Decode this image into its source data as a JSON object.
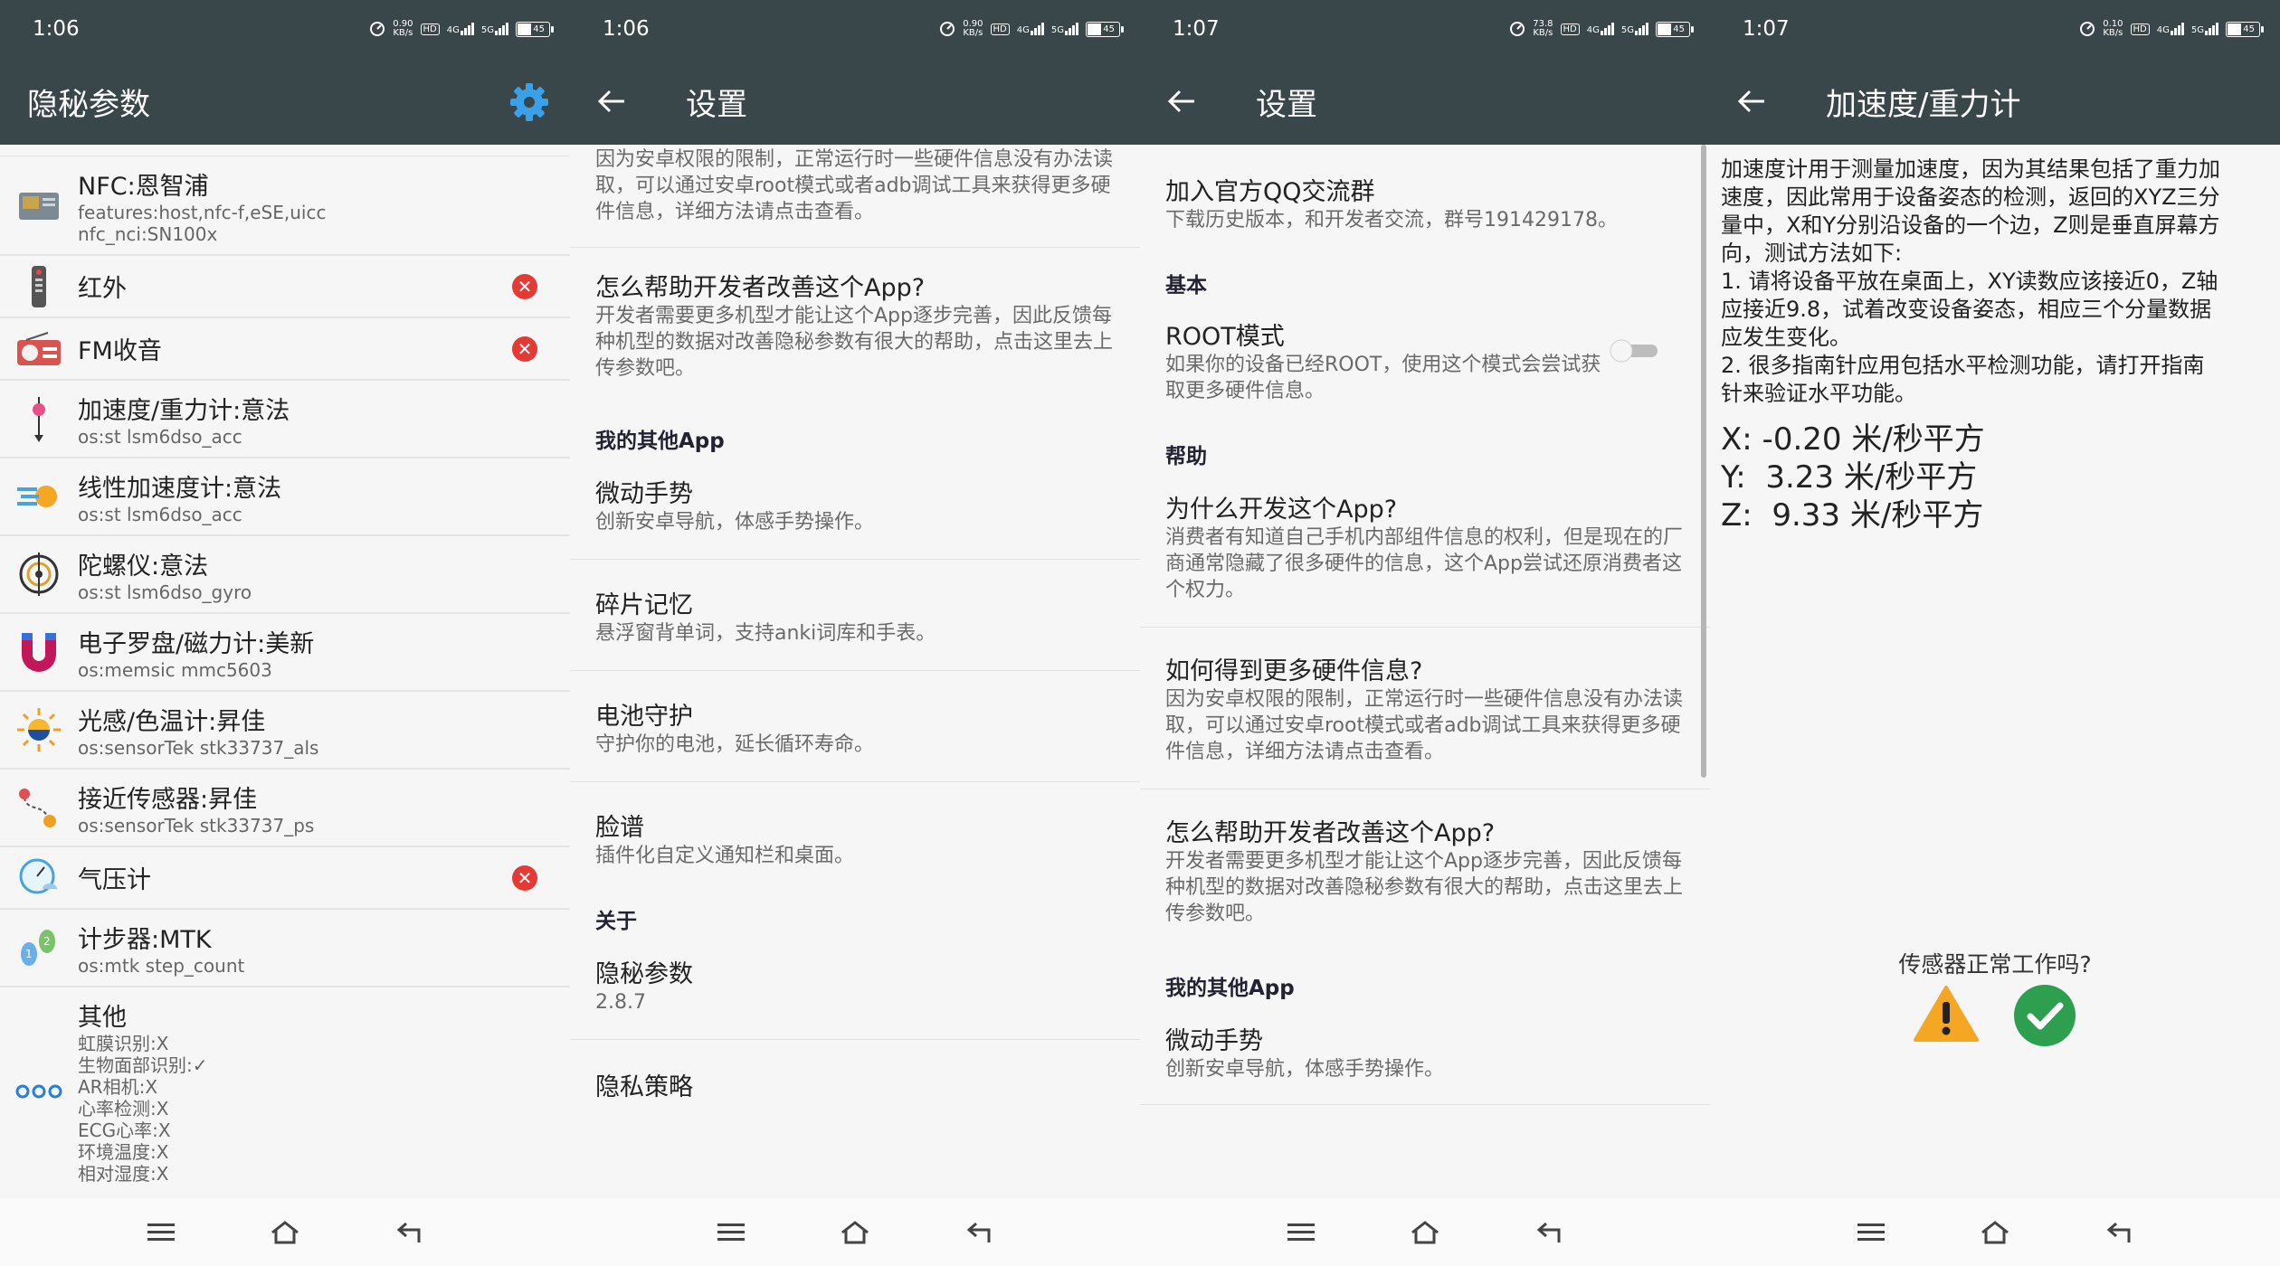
{
  "status": [
    {
      "time": "1:06",
      "speed_top": "0.90",
      "speed_unit": "KB/s",
      "hd": "HD",
      "net1": "4G",
      "net2": "5G",
      "battery": "45"
    },
    {
      "time": "1:06",
      "speed_top": "0.90",
      "speed_unit": "KB/s",
      "hd": "HD",
      "net1": "4G",
      "net2": "5G",
      "battery": "45"
    },
    {
      "time": "1:07",
      "speed_top": "73.8",
      "speed_unit": "KB/s",
      "hd": "HD",
      "net1": "4G",
      "net2": "5G",
      "battery": "45"
    },
    {
      "time": "1:07",
      "speed_top": "0.10",
      "speed_unit": "KB/s",
      "hd": "HD",
      "net1": "4G",
      "net2": "5G",
      "battery": "45"
    }
  ],
  "screen1": {
    "title": "隐秘参数",
    "sensors": [
      {
        "name": "NFC:恩智浦",
        "sub": [
          "features:host,nfc-f,eSE,uicc",
          "nfc_nci:SN100x"
        ],
        "icon": "nfc-chip-icon",
        "error": false
      },
      {
        "name": "红外",
        "sub": [],
        "icon": "remote-control-icon",
        "error": true
      },
      {
        "name": "FM收音",
        "sub": [],
        "icon": "radio-icon",
        "error": true
      },
      {
        "name": "加速度/重力计:意法",
        "sub": [
          "os:st lsm6dso_acc"
        ],
        "icon": "gravity-pendulum-icon",
        "error": false
      },
      {
        "name": "线性加速度计:意法",
        "sub": [
          "os:st lsm6dso_acc"
        ],
        "icon": "speed-lines-icon",
        "error": false
      },
      {
        "name": "陀螺仪:意法",
        "sub": [
          "os:st lsm6dso_gyro"
        ],
        "icon": "gyroscope-icon",
        "error": false
      },
      {
        "name": "电子罗盘/磁力计:美新",
        "sub": [
          "os:memsic mmc5603"
        ],
        "icon": "magnet-icon",
        "error": false
      },
      {
        "name": "光感/色温计:昇佳",
        "sub": [
          "os:sensorTek stk33737_als"
        ],
        "icon": "sun-icon",
        "error": false
      },
      {
        "name": "接近传感器:昇佳",
        "sub": [
          "os:sensorTek stk33737_ps"
        ],
        "icon": "location-route-icon",
        "error": false
      },
      {
        "name": "气压计",
        "sub": [],
        "icon": "weather-gauge-icon",
        "error": true
      },
      {
        "name": "计步器:MTK",
        "sub": [
          "os:mtk step_count"
        ],
        "icon": "footsteps-icon",
        "error": false
      },
      {
        "name": "其他",
        "sub": [
          "虹膜识别:X",
          "生物面部识别:✓",
          "AR相机:X",
          "心率检测:X",
          "ECG心率:X",
          "环境温度:X",
          "相对湿度:X"
        ],
        "icon": "more-dots-icon",
        "error": false
      }
    ]
  },
  "screen2": {
    "title": "设置",
    "top_desc": "因为安卓权限的限制，正常运行时一些硬件信息没有办法读取，可以通过安卓root模式或者adb调试工具来获得更多硬件信息，详细方法请点击查看。",
    "items_a": [
      {
        "title": "怎么帮助开发者改善这个App?",
        "desc": "开发者需要更多机型才能让这个App逐步完善，因此反馈每种机型的数据对改善隐秘参数有很大的帮助，点击这里去上传参数吧。"
      }
    ],
    "cat_other": "我的其他App",
    "items_b": [
      {
        "title": "微动手势",
        "desc": "创新安卓导航，体感手势操作。"
      },
      {
        "title": "碎片记忆",
        "desc": "悬浮窗背单词，支持anki词库和手表。"
      },
      {
        "title": "电池守护",
        "desc": "守护你的电池，延长循环寿命。"
      },
      {
        "title": "脸谱",
        "desc": "插件化自定义通知栏和桌面。"
      }
    ],
    "cat_about": "关于",
    "items_c": [
      {
        "title": "隐秘参数",
        "desc": "2.8.7"
      },
      {
        "title": "隐私策略",
        "desc": ""
      }
    ]
  },
  "screen3": {
    "title": "设置",
    "qq": {
      "title": "加入官方QQ交流群",
      "desc": "下载历史版本，和开发者交流，群号191429178。"
    },
    "cat_basic": "基本",
    "root": {
      "title": "ROOT模式",
      "desc": "如果你的设备已经ROOT，使用这个模式会尝试获取更多硬件信息。",
      "enabled": false
    },
    "cat_help": "帮助",
    "help_items": [
      {
        "title": "为什么开发这个App?",
        "desc": "消费者有知道自己手机内部组件信息的权利，但是现在的厂商通常隐藏了很多硬件的信息，这个App尝试还原消费者这个权力。"
      },
      {
        "title": "如何得到更多硬件信息?",
        "desc": "因为安卓权限的限制，正常运行时一些硬件信息没有办法读取，可以通过安卓root模式或者adb调试工具来获得更多硬件信息，详细方法请点击查看。"
      },
      {
        "title": "怎么帮助开发者改善这个App?",
        "desc": "开发者需要更多机型才能让这个App逐步完善，因此反馈每种机型的数据对改善隐秘参数有很大的帮助，点击这里去上传参数吧。"
      }
    ],
    "cat_other": "我的其他App",
    "other_items": [
      {
        "title": "微动手势",
        "desc": "创新安卓导航，体感手势操作。"
      }
    ]
  },
  "screen4": {
    "title": "加速度/重力计",
    "desc_lines": [
      "加速度计用于测量加速度，因为其结果包括了重力加",
      "速度，因此常用于设备姿态的检测，返回的XYZ三分",
      "量中，X和Y分别沿设备的一个边，Z则是垂直屏幕方",
      "向，测试方法如下:",
      "1. 请将设备平放在桌面上，XY读数应该接近0，Z轴",
      "应接近9.8，试着改变设备姿态，相应三个分量数据",
      "应发生变化。",
      "2. 很多指南针应用包括水平检测功能，请打开指南",
      "针来验证水平功能。"
    ],
    "readings": [
      "X: -0.20 米/秒平方",
      "Y:  3.23 米/秒平方",
      "Z:  9.33 米/秒平方"
    ],
    "question": "传感器正常工作吗?"
  },
  "colors": {
    "appbar": "#39464a",
    "error": "#e53935",
    "ok": "#2e9e4f",
    "warn": "#f5a623"
  }
}
